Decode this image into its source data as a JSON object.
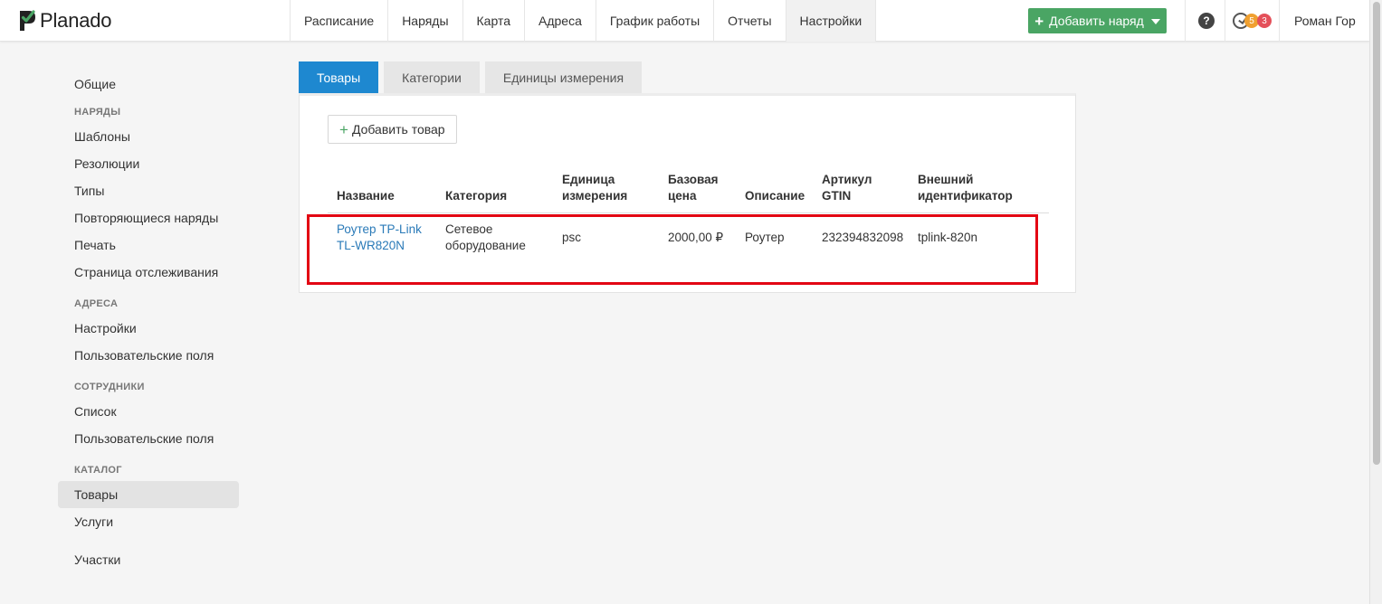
{
  "app": {
    "logo_text": "Planado"
  },
  "nav": [
    "Расписание",
    "Наряды",
    "Карта",
    "Адреса",
    "График работы",
    "Отчеты",
    "Настройки"
  ],
  "header": {
    "add_order_label": "Добавить наряд",
    "help_icon": "?",
    "badge_orange": "5",
    "badge_red": "3",
    "user_name": "Роман Гор"
  },
  "sidebar": {
    "general": "Общие",
    "sections": [
      {
        "title": "Наряды",
        "items": [
          "Шаблоны",
          "Резолюции",
          "Типы",
          "Повторяющиеся наряды",
          "Печать",
          "Страница отслеживания"
        ]
      },
      {
        "title": "Адреса",
        "items": [
          "Настройки",
          "Пользовательские поля"
        ]
      },
      {
        "title": "Сотрудники",
        "items": [
          "Список",
          "Пользовательские поля"
        ]
      },
      {
        "title": "Каталог",
        "items": [
          "Товары",
          "Услуги"
        ]
      }
    ],
    "extra": "Участки"
  },
  "tabs": [
    "Товары",
    "Категории",
    "Единицы измерения"
  ],
  "add_product_label": "Добавить товар",
  "table": {
    "headers": {
      "name": "Название",
      "category": "Категория",
      "unit_1": "Единица",
      "unit_2": "измерения",
      "price_1": "Базовая",
      "price_2": "цена",
      "description": "Описание",
      "gtin_1": "Артикул",
      "gtin_2": "GTIN",
      "ext_1": "Внешний",
      "ext_2": "идентификатор"
    },
    "rows": [
      {
        "name_1": "Роутер TP-Link",
        "name_2": "TL-WR820N",
        "category_1": "Сетевое",
        "category_2": "оборудование",
        "unit": "psc",
        "price": "2000,00 ₽",
        "description": "Роутер",
        "gtin": "232394832098",
        "external_id": "tplink-820n"
      }
    ]
  },
  "colors": {
    "accent_blue": "#1e88d0",
    "add_green": "#4aa564",
    "highlight_red": "#e30613",
    "link_blue": "#2a7ab8"
  }
}
